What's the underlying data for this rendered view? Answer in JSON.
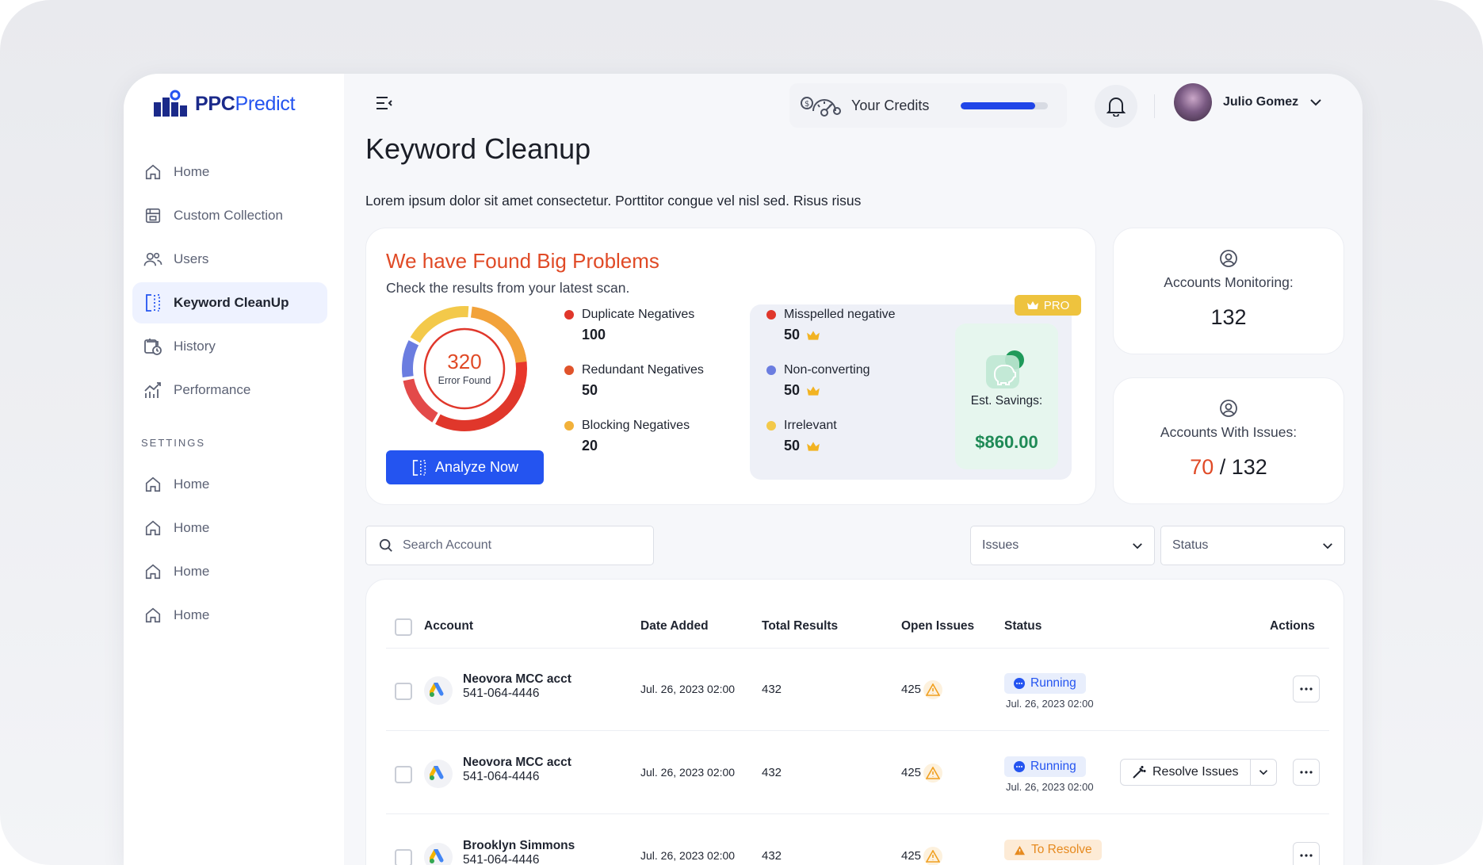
{
  "app": {
    "logo_bold": "PPC",
    "logo_light": "Predict"
  },
  "sidebar": {
    "items": [
      {
        "label": "Home",
        "icon": "home-icon"
      },
      {
        "label": "Custom Collection",
        "icon": "collection-icon"
      },
      {
        "label": "Users",
        "icon": "users-icon"
      },
      {
        "label": "Keyword CleanUp",
        "icon": "cleanup-icon",
        "active": true
      },
      {
        "label": "History",
        "icon": "history-icon"
      },
      {
        "label": "Performance",
        "icon": "performance-icon"
      }
    ],
    "settings_label": "SETTINGS",
    "settings_items": [
      {
        "label": "Home",
        "icon": "home-icon"
      },
      {
        "label": "Home",
        "icon": "home-icon"
      },
      {
        "label": "Home",
        "icon": "home-icon"
      },
      {
        "label": "Home",
        "icon": "home-icon"
      }
    ]
  },
  "topbar": {
    "credits_label": "Your Credits",
    "credits_fraction": 0.85,
    "user_name": "Julio Gomez"
  },
  "page": {
    "title": "Keyword Cleanup",
    "subtitle": "Lorem ipsum dolor sit amet consectetur. Porttitor congue vel nisl sed. Risus risus"
  },
  "problems": {
    "title": "We have Found Big Problems",
    "subtitle": "Check the results from your latest scan.",
    "error_count": "320",
    "error_label": "Error Found",
    "analyze_label": "Analyze Now",
    "stats": [
      {
        "label": "Duplicate Negatives",
        "value": "100",
        "color": "#e0372b"
      },
      {
        "label": "Redundant Negatives",
        "value": "50",
        "color": "#e0532b"
      },
      {
        "label": "Blocking Negatives",
        "value": "20",
        "color": "#f2b13a"
      }
    ],
    "pro_badge": "PRO",
    "pro_stats": [
      {
        "label": "Misspelled negative",
        "value": "50",
        "color": "#e0372b"
      },
      {
        "label": "Non-converting",
        "value": "50",
        "color": "#6b7de0"
      },
      {
        "label": "Irrelevant",
        "value": "50",
        "color": "#f3c94a"
      }
    ],
    "savings_label": "Est. Savings:",
    "savings_value": "$860.00"
  },
  "summary": {
    "monitoring_label": "Accounts Monitoring:",
    "monitoring_value": "132",
    "issues_label": "Accounts With Issues:",
    "issues_value": "70",
    "issues_sep": " / ",
    "issues_total": "132"
  },
  "filters": {
    "search_placeholder": "Search Account",
    "issues_label": "Issues",
    "status_label": "Status"
  },
  "table": {
    "headers": {
      "account": "Account",
      "date": "Date Added",
      "total": "Total Results",
      "open": "Open Issues",
      "status": "Status",
      "actions": "Actions"
    },
    "resolve_label": "Resolve Issues",
    "rows": [
      {
        "name": "Neovora MCC acct",
        "number": "541-064-4446",
        "date": "Jul. 26, 2023 02:00",
        "total": "432",
        "open": "425",
        "status": "Running",
        "status_date": "Jul. 26, 2023 02:00"
      },
      {
        "name": "Neovora MCC acct",
        "number": "541-064-4446",
        "date": "Jul. 26, 2023 02:00",
        "total": "432",
        "open": "425",
        "status": "Running",
        "status_date": "Jul. 26, 2023 02:00"
      },
      {
        "name": "Brooklyn Simmons",
        "number": "541-064-4446",
        "date": "Jul. 26, 2023 02:00",
        "total": "432",
        "open": "425",
        "status": "To Resolve",
        "status_date": ""
      }
    ]
  }
}
